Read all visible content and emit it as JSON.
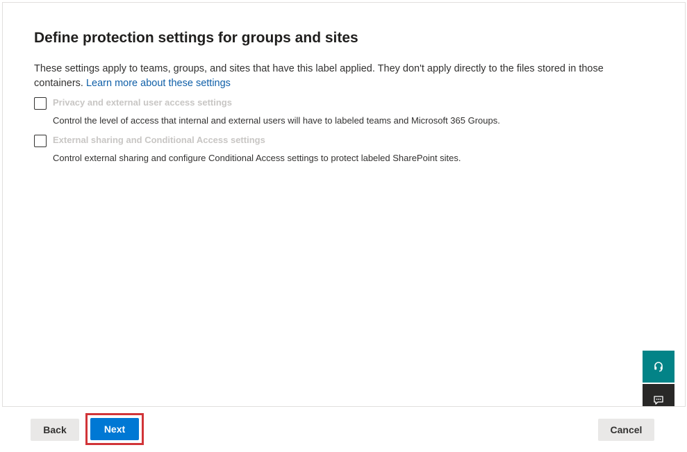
{
  "page": {
    "title": "Define protection settings for groups and sites",
    "description": "These settings apply to teams, groups, and sites that have this label applied. They don't apply directly to the files stored in those containers. ",
    "learn_more_link": "Learn more about these settings"
  },
  "options": [
    {
      "label": "Privacy and external user access settings",
      "description": "Control the level of access that internal and external users will have to labeled teams and Microsoft 365 Groups.",
      "checked": false
    },
    {
      "label": "External sharing and Conditional Access settings",
      "description": "Control external sharing and configure Conditional Access settings to protect labeled SharePoint sites.",
      "checked": false
    }
  ],
  "footer": {
    "back_label": "Back",
    "next_label": "Next",
    "cancel_label": "Cancel"
  },
  "side_actions": {
    "help_icon": "headset-icon",
    "feedback_icon": "feedback-icon"
  },
  "colors": {
    "primary": "#0078d4",
    "highlight": "#d13438",
    "help_bg": "#038387",
    "feedback_bg": "#292827"
  }
}
